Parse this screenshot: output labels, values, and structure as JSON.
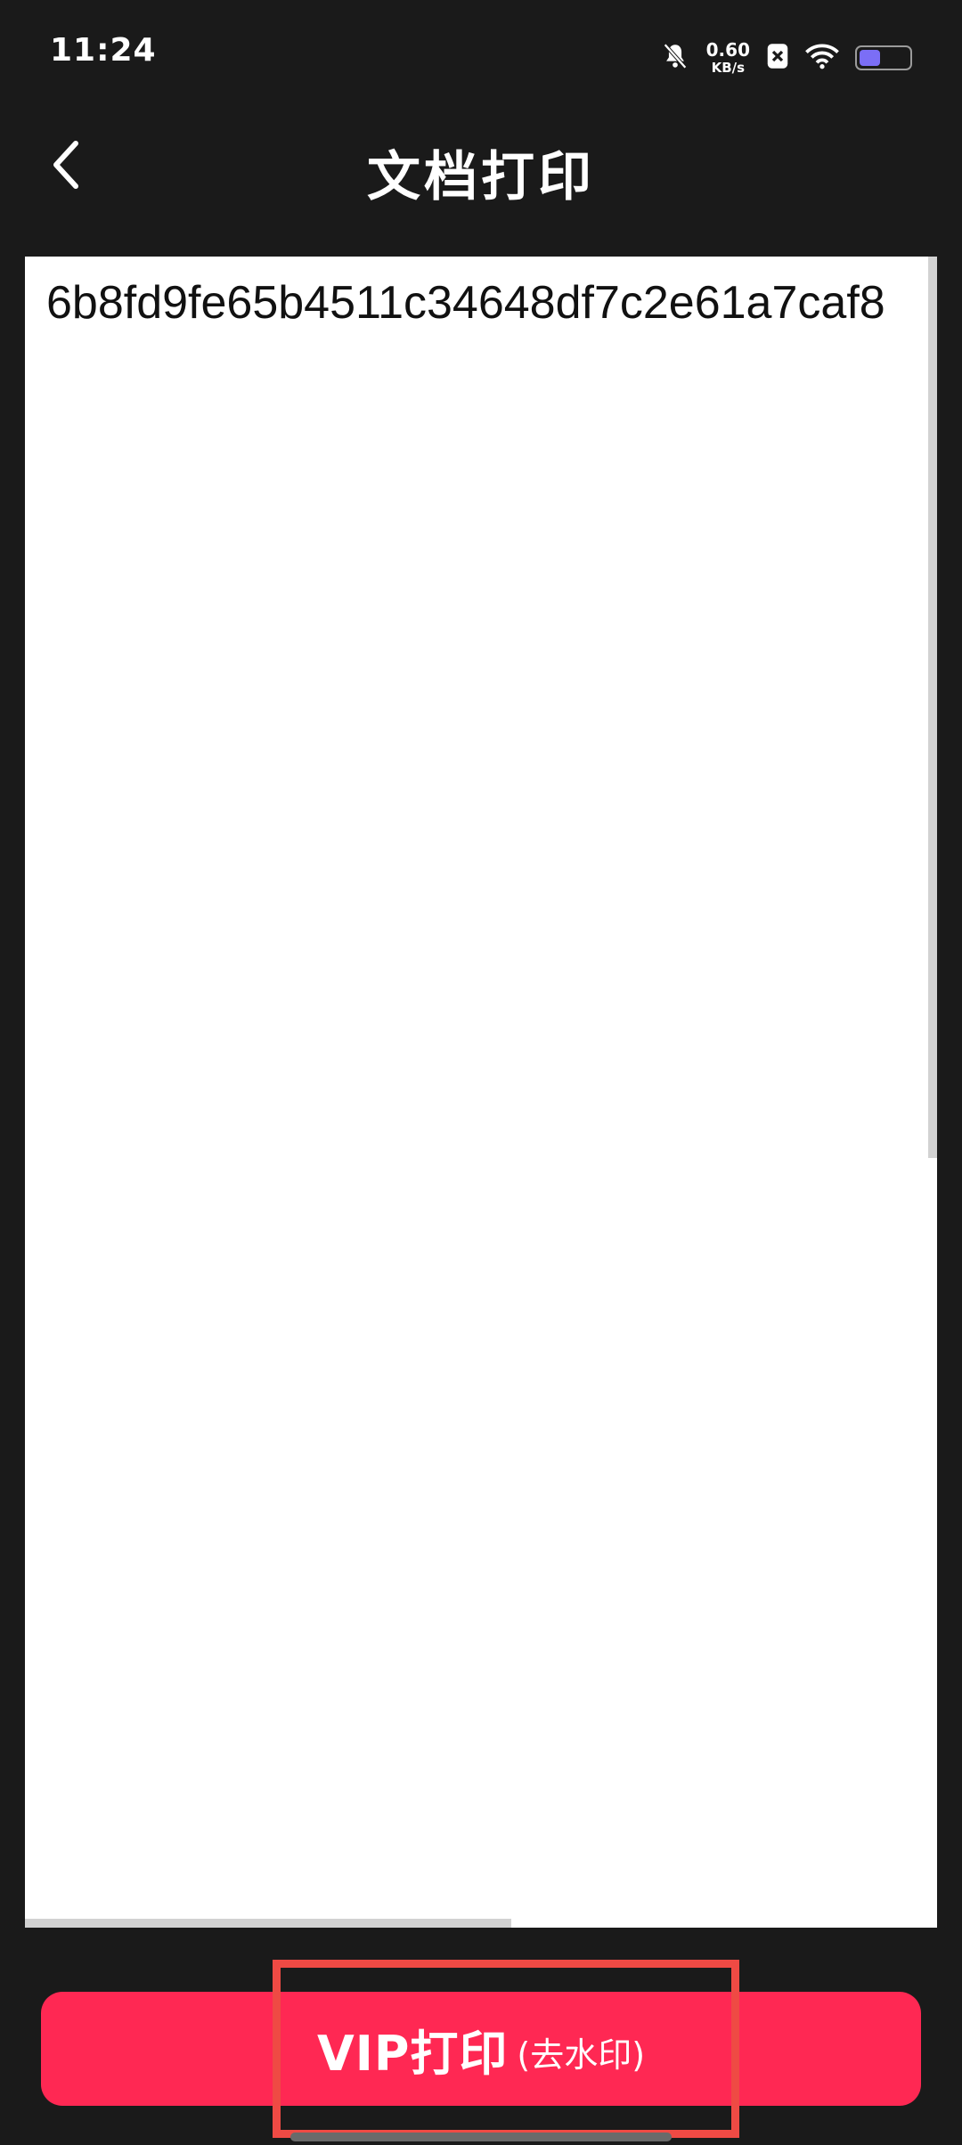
{
  "status_bar": {
    "time": "11:24",
    "net_speed_value": "0.60",
    "net_speed_unit": "KB/s",
    "battery_level": 0.42,
    "icons": [
      "bell-off-icon",
      "x-app-icon",
      "wifi-icon",
      "battery-icon"
    ]
  },
  "header": {
    "back_icon": "chevron-left-icon",
    "title": "文档打印"
  },
  "document": {
    "content": "6b8fd9fe65b4511c34648df7c2e61a7caf8"
  },
  "footer": {
    "vip_label": "VIP打印",
    "vip_sub_label": "(去水印)"
  },
  "colors": {
    "background": "#1a1a1a",
    "accent": "#ff2853",
    "highlight": "#ef4a44",
    "battery": "#7b6ef6"
  }
}
